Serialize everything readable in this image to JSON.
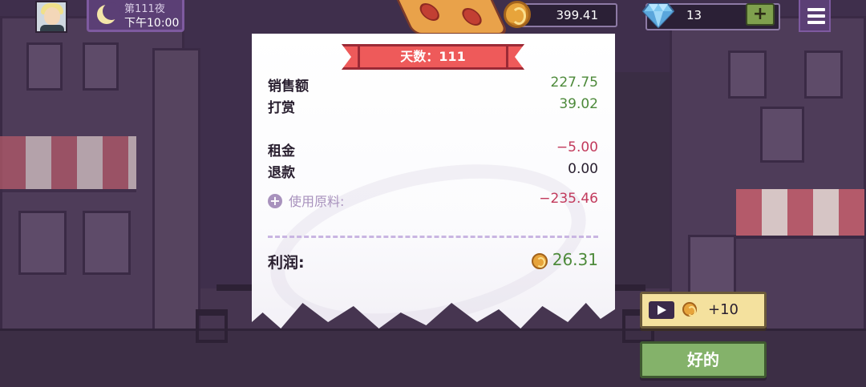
{
  "hud": {
    "night_label": "第111夜",
    "time_label": "下午10:00",
    "coins": "399.41",
    "gems": "13",
    "plus_label": "+",
    "icons": [
      "avatar",
      "moon-icon",
      "coin-icon",
      "gem-icon",
      "menu-icon"
    ]
  },
  "receipt": {
    "banner": "天数：111",
    "rows": [
      {
        "label": "销售额",
        "value": "227.75"
      },
      {
        "label": "打赏",
        "value": "39.02"
      },
      {
        "label": "租金",
        "value": "−5.00"
      },
      {
        "label": "退款",
        "value": "0.00"
      }
    ],
    "ingredients_label": "使用原料:",
    "ingredients_value": "−235.46",
    "expand_symbol": "+",
    "profit_label": "利润:",
    "profit_value": "26.31"
  },
  "actions": {
    "video_reward": "+10",
    "ok_label": "好的"
  },
  "colors": {
    "positive": "#4d8a3a",
    "negative": "#c23a5c",
    "banner": "#ee5a5a",
    "ok_button": "#84b26a",
    "video_button": "#f4e19e"
  }
}
